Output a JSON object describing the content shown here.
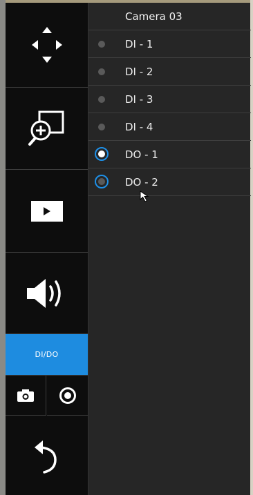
{
  "header": {
    "camera_title": "Camera 03"
  },
  "io_list": [
    {
      "label": "DI - 1",
      "kind": "input",
      "state": "inactive"
    },
    {
      "label": "DI - 2",
      "kind": "input",
      "state": "inactive"
    },
    {
      "label": "DI - 3",
      "kind": "input",
      "state": "inactive"
    },
    {
      "label": "DI - 4",
      "kind": "input",
      "state": "inactive"
    },
    {
      "label": "DO - 1",
      "kind": "output",
      "state": "on"
    },
    {
      "label": "DO - 2",
      "kind": "output",
      "state": "off"
    }
  ],
  "sidebar": {
    "buttons": [
      {
        "icon": "ptz-arrows-icon"
      },
      {
        "icon": "digital-zoom-icon"
      },
      {
        "icon": "playback-icon"
      },
      {
        "icon": "speaker-icon"
      },
      {
        "label": "DI/DO",
        "active": true
      },
      {
        "icon": "snapshot-icon"
      },
      {
        "icon": "record-icon"
      },
      {
        "icon": "back-icon"
      }
    ]
  },
  "colors": {
    "accent": "#1e8ce0",
    "radio_on": "#ffffff",
    "radio_off": "#5a5a5a",
    "panel_bg": "#262626",
    "sidebar_bg": "#0d0d0d"
  }
}
